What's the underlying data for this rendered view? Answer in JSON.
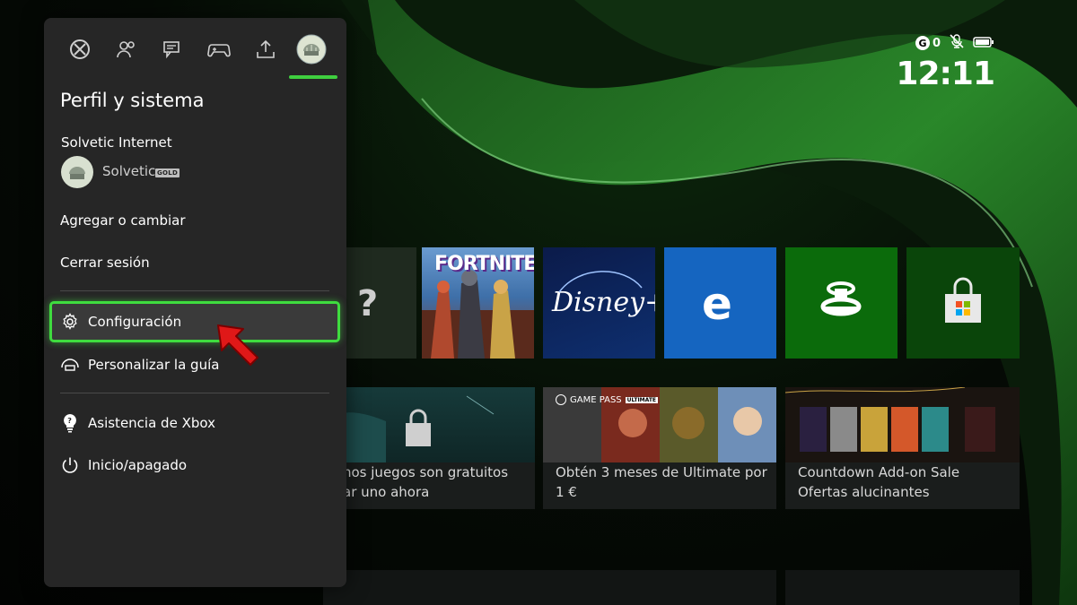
{
  "status": {
    "g_label": "G",
    "g_count": "0",
    "mic_icon": "mic-muted-icon",
    "battery_icon": "battery-icon",
    "time": "12:11"
  },
  "guide": {
    "tabs": [
      {
        "icon": "xbox-icon"
      },
      {
        "icon": "people-icon"
      },
      {
        "icon": "chat-icon"
      },
      {
        "icon": "controller-icon"
      },
      {
        "icon": "share-upload-icon"
      },
      {
        "icon": "profile-avatar-icon"
      }
    ],
    "title": "Perfil y sistema",
    "account_name": "Solvetic Internet",
    "gamertag": "Solvetic",
    "gold_badge": "GOLD",
    "menu": {
      "add_or_change": "Agregar o cambiar",
      "sign_out": "Cerrar sesión",
      "settings": "Configuración",
      "customize_guide": "Personalizar la guía",
      "xbox_support": "Asistencia de Xbox",
      "power": "Inicio/apagado"
    }
  },
  "home": {
    "tiles": [
      {
        "name": "help",
        "icon": "question-bulb-icon"
      },
      {
        "name": "fortnite",
        "label": "FORTNITE"
      },
      {
        "name": "disney",
        "label": "Disney+"
      },
      {
        "name": "edge",
        "icon": "edge-icon"
      },
      {
        "name": "companion",
        "icon": "companion-icon"
      },
      {
        "name": "store",
        "icon": "store-bag-icon"
      }
    ],
    "cards": {
      "free_line1": "nos juegos son gratuitos",
      "free_line2": "ar uno ahora",
      "gamepass_badge": "GAME PASS",
      "gamepass_tier": "ULTIMATE",
      "gamepass_line1": "Obtén 3 meses de Ultimate por",
      "gamepass_line2": "1 €",
      "countdown_line1": "Countdown Add-on Sale",
      "countdown_line2": "Ofertas alucinantes"
    }
  },
  "colors": {
    "accent_green": "#3fdc3f",
    "panel_bg": "#262626",
    "edge_blue": "#1565c0",
    "tile_green": "#0b6b0b"
  }
}
